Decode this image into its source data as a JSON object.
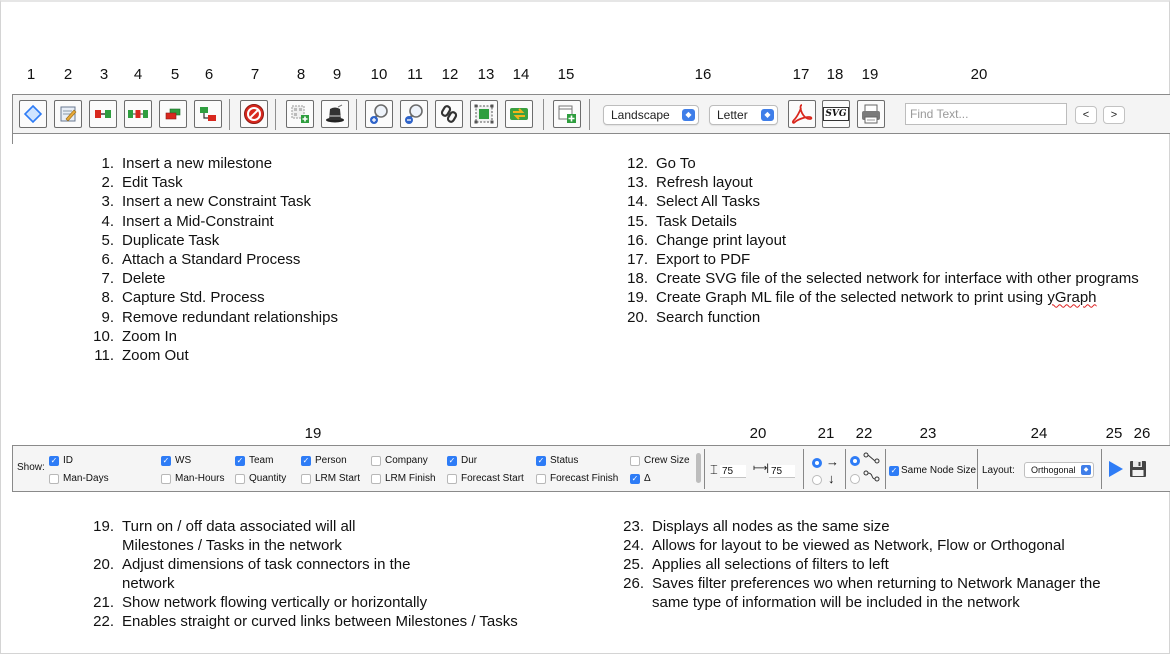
{
  "top_numbers": [
    "1",
    "2",
    "3",
    "4",
    "5",
    "6",
    "7",
    "8",
    "9",
    "10",
    "11",
    "12",
    "13",
    "14",
    "15",
    "16",
    "17",
    "18",
    "19",
    "20"
  ],
  "toolbar": {
    "orientation_value": "Landscape",
    "paper_value": "Letter",
    "svg_label": "SVG",
    "find_placeholder": "Find Text...",
    "prev_label": "<",
    "next_label": ">"
  },
  "top_list_left": [
    {
      "n": "1.",
      "t": "Insert a new milestone"
    },
    {
      "n": "2.",
      "t": "Edit Task"
    },
    {
      "n": "3.",
      "t": "Insert a new Constraint Task"
    },
    {
      "n": "4.",
      "t": "Insert a Mid-Constraint"
    },
    {
      "n": "5.",
      "t": "Duplicate Task"
    },
    {
      "n": "6.",
      "t": "Attach a Standard Process"
    },
    {
      "n": "7.",
      "t": "Delete"
    },
    {
      "n": "8.",
      "t": "Capture Std. Process"
    },
    {
      "n": "9.",
      "t": "Remove redundant relationships"
    },
    {
      "n": "10.",
      "t": "Zoom In"
    },
    {
      "n": "11.",
      "t": "Zoom Out"
    }
  ],
  "top_list_right": [
    {
      "n": "12.",
      "t": "Go To"
    },
    {
      "n": "13.",
      "t": "Refresh layout"
    },
    {
      "n": "14.",
      "t": "Select All Tasks"
    },
    {
      "n": "15.",
      "t": "Task Details"
    },
    {
      "n": "16.",
      "t": "Change print layout"
    },
    {
      "n": "17.",
      "t": "Export to PDF"
    },
    {
      "n": "18.",
      "t": "Create SVG file of the selected network for interface with other programs"
    },
    {
      "n": "19.",
      "t_pre": "Create Graph ML file of the selected network to print using ",
      "t_squig": "yGraph"
    },
    {
      "n": "20.",
      "t": "Search function"
    }
  ],
  "bottom_numbers": [
    "19",
    "20",
    "21",
    "22",
    "23",
    "24",
    "25",
    "26"
  ],
  "filters": {
    "show_label": "Show:",
    "row1": [
      {
        "label": "ID",
        "checked": true
      },
      {
        "label": "WS",
        "checked": true
      },
      {
        "label": "Team",
        "checked": true
      },
      {
        "label": "Person",
        "checked": true
      },
      {
        "label": "Company",
        "checked": false
      },
      {
        "label": "Dur",
        "checked": true
      },
      {
        "label": "Status",
        "checked": true
      },
      {
        "label": "Crew Size",
        "checked": false
      }
    ],
    "row2": [
      {
        "label": "Man-Days",
        "checked": false
      },
      {
        "label": "Man-Hours",
        "checked": false
      },
      {
        "label": "Quantity",
        "checked": false
      },
      {
        "label": "LRM Start",
        "checked": false
      },
      {
        "label": "LRM Finish",
        "checked": false
      },
      {
        "label": "Forecast Start",
        "checked": false
      },
      {
        "label": "Forecast Finish",
        "checked": false
      },
      {
        "label": "Δ",
        "checked": true
      }
    ],
    "height_value": "75",
    "width_value": "75",
    "same_node_size_label": "Same Node Size",
    "layout_label": "Layout:",
    "layout_value": "Orthogonal",
    "checkmark": "✓"
  },
  "bottom_list_left": [
    {
      "n": "19.",
      "t": "Turn on / off data associated will all Milestones / Tasks in the network"
    },
    {
      "n": "20.",
      "t": "Adjust dimensions of task connectors in the network"
    },
    {
      "n": "21.",
      "t": "Show network flowing vertically or horizontally"
    },
    {
      "n": "22.",
      "t": "Enables straight or curved links between Milestones / Tasks"
    }
  ],
  "bottom_list_right": [
    {
      "n": "23.",
      "t": "Displays all nodes as the same size"
    },
    {
      "n": "24.",
      "t": "Allows for layout to be viewed as Network, Flow or Orthogonal"
    },
    {
      "n": "25.",
      "t": "Applies all selections of filters to left"
    },
    {
      "n": "26.",
      "t": "Saves filter preferences wo when returning to Network Manager the same type of information will be included in the network"
    }
  ],
  "colors": {
    "accent_blue": "#2e7cf6",
    "delete_red": "#d8281e",
    "pdf_red": "#d9261c",
    "green": "#2f9e3f"
  },
  "icons": [
    "milestone-diamond-icon",
    "edit-task-icon",
    "constraint-task-icon",
    "mid-constraint-icon",
    "duplicate-task-icon",
    "standard-process-icon",
    "delete-icon",
    "capture-process-icon",
    "magic-hat-icon",
    "zoom-in-icon",
    "zoom-out-icon",
    "goto-link-icon",
    "refresh-layout-icon",
    "select-all-icon",
    "task-details-icon",
    "pdf-icon",
    "svg-icon",
    "printer-icon",
    "play-icon",
    "save-disk-icon"
  ]
}
